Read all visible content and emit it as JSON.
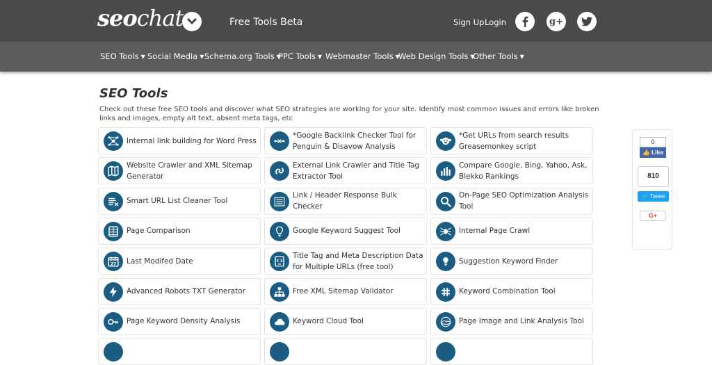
{
  "header": {
    "logo_bold": "seo",
    "logo_light": "chat",
    "tagline": "Free Tools Beta",
    "signup": "Sign Up",
    "login": "Login",
    "social": [
      {
        "name": "facebook-icon",
        "glyph": "f"
      },
      {
        "name": "google-plus-icon",
        "glyph": "g+"
      },
      {
        "name": "twitter-icon",
        "glyph": "t"
      }
    ]
  },
  "nav": {
    "items": [
      "SEO Tools",
      "Social Media",
      "Schema.org Tools",
      "PPC Tools",
      "Webmaster Tools",
      "Web Design Tools",
      "Other Tools"
    ]
  },
  "main": {
    "title": "SEO Tools",
    "description": "Check out these free SEO tools and discover what SEO strategies are working for your site. Identify most common issues and errors like broken links and images, empty alt text, absent meta tags, etc",
    "tools": [
      {
        "label": "Internal link building for Word Press",
        "icon": "network-icon"
      },
      {
        "label": "*Google Backlink Checker Tool for Penguin & Disavow Analysis",
        "icon": "link-icon"
      },
      {
        "label": "*Get URLs from search results Greasemonkey script",
        "icon": "monkey-icon"
      },
      {
        "label": "Website Crawler and XML Sitemap Generator",
        "icon": "map-icon"
      },
      {
        "label": "External Link Crawler and Title Tag Extractor Tool",
        "icon": "chain-icon"
      },
      {
        "label": "Compare Google, Bing, Yahoo, Ask, Blekko Rankings",
        "icon": "bar-chart-icon"
      },
      {
        "label": "Smart URL List Cleaner Tool",
        "icon": "list-clean-icon"
      },
      {
        "label": "Link / Header Response Bulk Checker",
        "icon": "list-icon"
      },
      {
        "label": "On-Page SEO Optimization Analysis Tool",
        "icon": "magnifier-icon"
      },
      {
        "label": "Page Comparison",
        "icon": "columns-icon"
      },
      {
        "label": "Google Keyword Suggest Tool",
        "icon": "lightbulb-icon"
      },
      {
        "label": "Internal Page Crawl",
        "icon": "spider-icon"
      },
      {
        "label": "Last Modifed Date",
        "icon": "calendar-icon"
      },
      {
        "label": "Title Tag and Meta Description Data for Multiple URLs (free tool)",
        "icon": "code-icon"
      },
      {
        "label": "Suggestion Keyword Finder",
        "icon": "idea-bulb-icon"
      },
      {
        "label": "Advanced Robots TXT Generator",
        "icon": "bolt-icon"
      },
      {
        "label": "Free XML Sitemap Validator",
        "icon": "sitemap-icon"
      },
      {
        "label": "Keyword Combination Tool",
        "icon": "combine-icon"
      },
      {
        "label": "Page Keyword Density Analysis",
        "icon": "key-icon"
      },
      {
        "label": "Keyword Cloud Tool",
        "icon": "cloud-icon"
      },
      {
        "label": "Page Image and Link Analysis Tool",
        "icon": "image-icon"
      }
    ]
  },
  "share": {
    "fb_count": "0",
    "fb_label": "Like",
    "tw_count": "810",
    "tw_label": "Tweet",
    "gp_label": "G+"
  },
  "colors": {
    "topbar": "#4a4a4a",
    "navbar": "#5c5c5c",
    "icon_bg": "#1b5d82"
  }
}
